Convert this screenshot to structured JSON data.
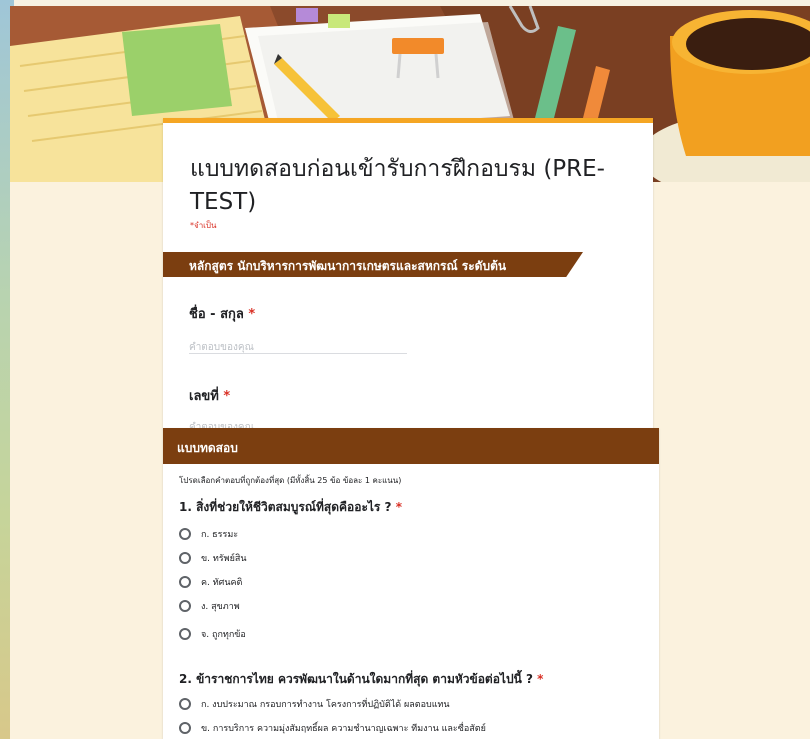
{
  "form": {
    "title": "แบบทดสอบก่อนเข้ารับการฝึกอบรม (PRE-TEST)",
    "required_note": "*จำเป็น",
    "section_banner": "หลักสูตร นักบริหารการพัฒนาการเกษตรและสหกรณ์ ระดับต้น",
    "fields": [
      {
        "label": "ชื่อ - สกุล",
        "required_mark": "*",
        "placeholder": "คำตอบของคุณ"
      },
      {
        "label": "เลขที่",
        "required_mark": "*",
        "placeholder": "คำตอบของคุณ"
      }
    ]
  },
  "quiz": {
    "header": "แบบทดสอบ",
    "instruction": "โปรดเลือกคำตอบที่ถูกต้องที่สุด (มีทั้งสิ้น 25 ข้อ ข้อละ 1 คะแนน)",
    "questions": [
      {
        "text": "1. สิ่งที่ช่วยให้ชีวิตสมบูรณ์ที่สุดคืออะไร ?",
        "required_mark": "*",
        "options": [
          "ก. ธรรมะ",
          "ข. ทรัพย์สิน",
          "ค. ทัศนคติ",
          "ง. สุขภาพ",
          "จ. ถูกทุกข้อ"
        ]
      },
      {
        "text": "2. ข้าราชการไทย ควรพัฒนาในด้านใดมากที่สุด ตามหัวข้อต่อไปนี้ ?",
        "required_mark": "*",
        "options": [
          "ก. งบประมาณ กรอบการทำงาน โครงการที่ปฏิบัติได้ ผลตอบแทน",
          "ข. การบริการ ความมุ่งสัมฤทธิ์ผล ความชำนาญเฉพาะ ทีมงาน และซื่อสัตย์"
        ]
      }
    ]
  },
  "colors": {
    "accent_brown": "#7b3e10",
    "accent_orange": "#f5a623",
    "required_red": "#d93025",
    "page_bg": "#fbf2de"
  }
}
